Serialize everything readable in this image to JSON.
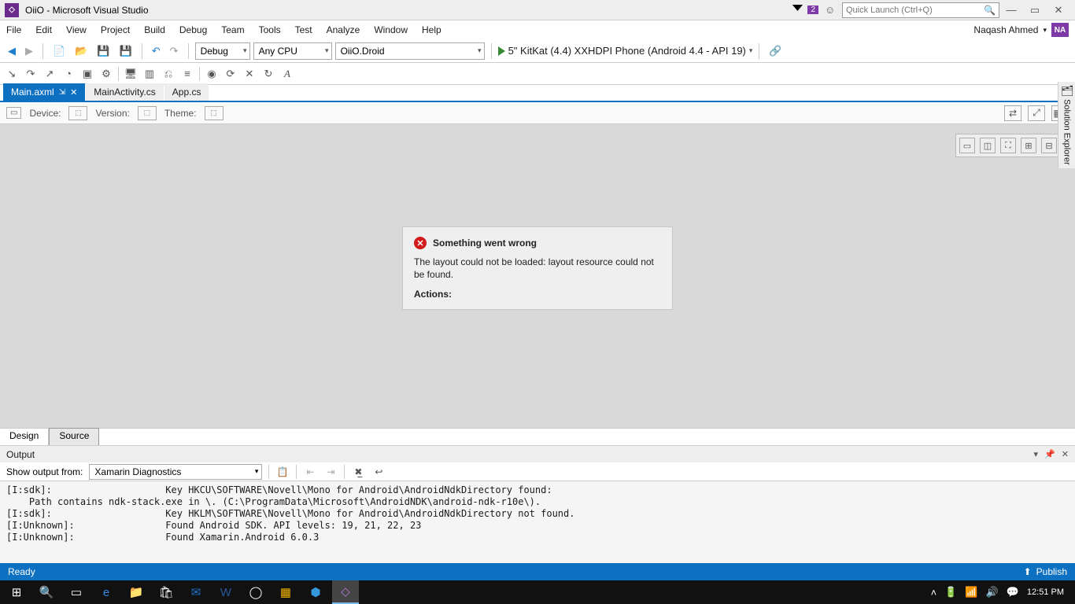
{
  "titlebar": {
    "title": "OiiO - Microsoft Visual Studio",
    "notification_count": "2",
    "quicklaunch_placeholder": "Quick Launch (Ctrl+Q)"
  },
  "menu": {
    "items": [
      "File",
      "Edit",
      "View",
      "Project",
      "Build",
      "Debug",
      "Team",
      "Tools",
      "Test",
      "Analyze",
      "Window",
      "Help"
    ],
    "user": "Naqash Ahmed",
    "user_initials": "NA"
  },
  "toolbar": {
    "config": "Debug",
    "platform": "Any CPU",
    "project": "OiiO.Droid",
    "device": "5\" KitKat (4.4) XXHDPI Phone (Android 4.4 - API 19)"
  },
  "tabs": [
    {
      "label": "Main.axml",
      "active": true,
      "pinned": true
    },
    {
      "label": "MainActivity.cs",
      "active": false,
      "pinned": false
    },
    {
      "label": "App.cs",
      "active": false,
      "pinned": false
    }
  ],
  "designer": {
    "device_label": "Device:",
    "version_label": "Version:",
    "theme_label": "Theme:"
  },
  "error": {
    "title": "Something went wrong",
    "message": "The layout could not be loaded: layout resource could not be found.",
    "actions_label": "Actions:"
  },
  "dstabs": {
    "design": "Design",
    "source": "Source"
  },
  "output": {
    "title": "Output",
    "from_label": "Show output from:",
    "from_value": "Xamarin Diagnostics",
    "lines": [
      "[I:sdk]:                    Key HKCU\\SOFTWARE\\Novell\\Mono for Android\\AndroidNdkDirectory found:",
      "    Path contains ndk-stack.exe in \\. (C:\\ProgramData\\Microsoft\\AndroidNDK\\android-ndk-r10e\\).",
      "[I:sdk]:                    Key HKLM\\SOFTWARE\\Novell\\Mono for Android\\AndroidNdkDirectory not found.",
      "[I:Unknown]:                Found Android SDK. API levels: 19, 21, 22, 23",
      "[I:Unknown]:                Found Xamarin.Android 6.0.3"
    ]
  },
  "statusbar": {
    "status": "Ready",
    "publish": "Publish"
  },
  "sidetool": {
    "label": "Solution Explorer"
  },
  "taskbar": {
    "time": "12:51 PM"
  }
}
